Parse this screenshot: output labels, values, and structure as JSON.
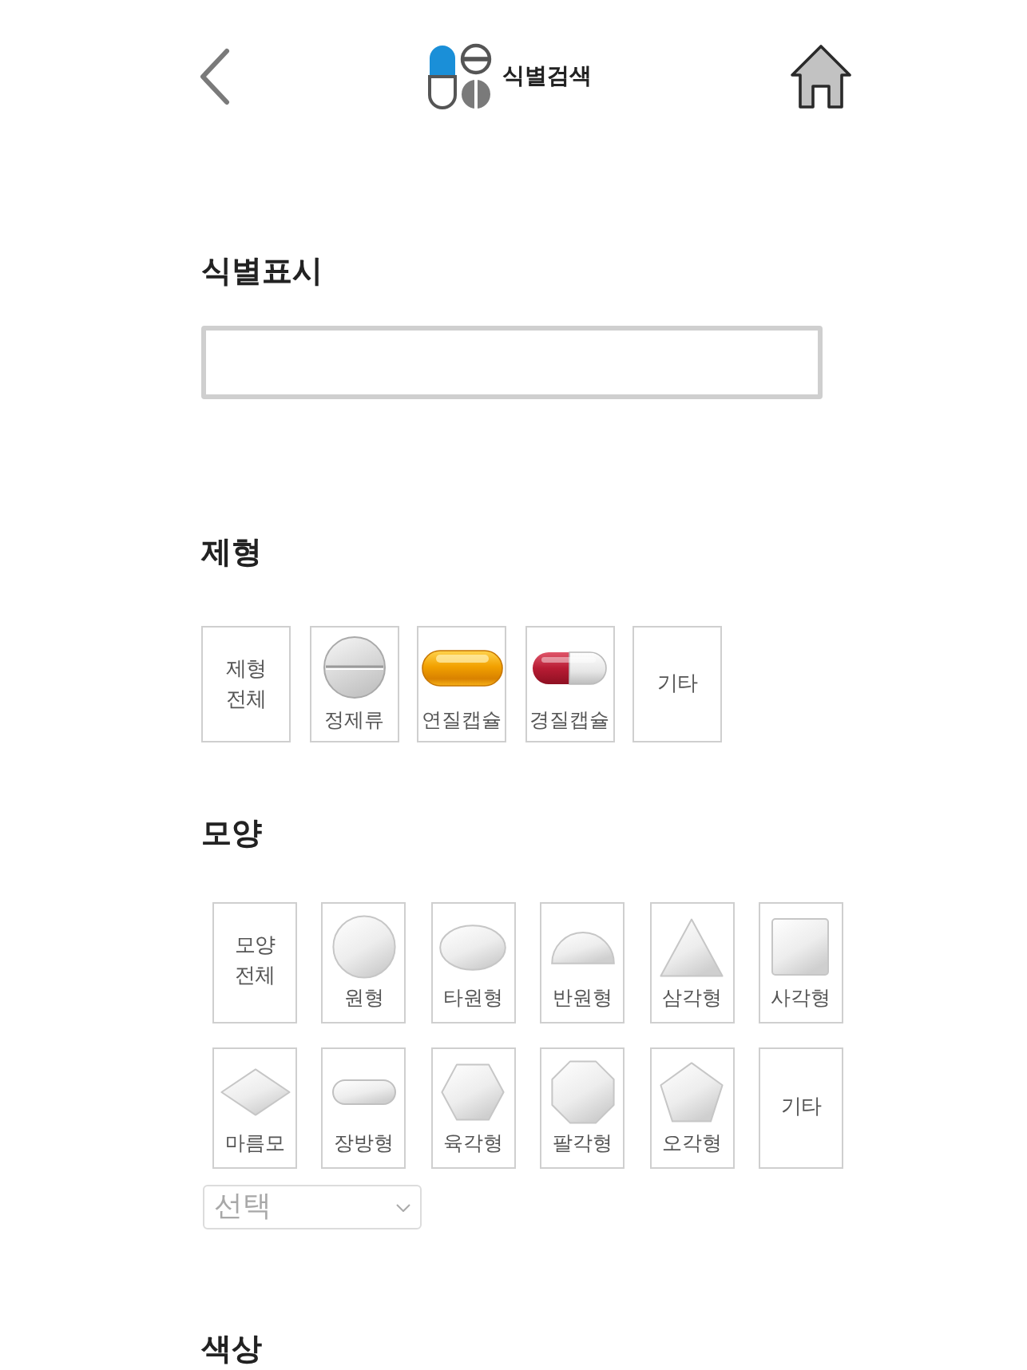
{
  "header": {
    "title": "식별검색"
  },
  "marking": {
    "heading": "식별표시"
  },
  "form": {
    "heading": "제형",
    "options": [
      {
        "kind": "all",
        "label": "제형 전체",
        "selected": false
      },
      {
        "kind": "tablet",
        "label": "정제류",
        "selected": false
      },
      {
        "kind": "soft_capsule",
        "label": "연질캡슐",
        "selected": false
      },
      {
        "kind": "hard_capsule",
        "label": "경질캡슐",
        "selected": false
      },
      {
        "kind": "other",
        "label": "기타",
        "selected": false
      }
    ]
  },
  "shape": {
    "heading": "모양",
    "options": [
      {
        "kind": "all",
        "label": "모양 전체",
        "selected": false
      },
      {
        "kind": "circle",
        "label": "원형",
        "selected": false
      },
      {
        "kind": "oval",
        "label": "타원형",
        "selected": false
      },
      {
        "kind": "semicircle",
        "label": "반원형",
        "selected": false
      },
      {
        "kind": "triangle",
        "label": "삼각형",
        "selected": false
      },
      {
        "kind": "square",
        "label": "사각형",
        "selected": false
      },
      {
        "kind": "rhombus",
        "label": "마름모",
        "selected": false
      },
      {
        "kind": "oblong",
        "label": "장방형",
        "selected": false
      },
      {
        "kind": "hexagon",
        "label": "육각형",
        "selected": false
      },
      {
        "kind": "octagon",
        "label": "팔각형",
        "selected": false
      },
      {
        "kind": "pentagon",
        "label": "오각형",
        "selected": false
      },
      {
        "kind": "other",
        "label": "기타",
        "selected": false
      }
    ],
    "select": {
      "value": "선택"
    }
  },
  "color": {
    "heading": "색상"
  }
}
